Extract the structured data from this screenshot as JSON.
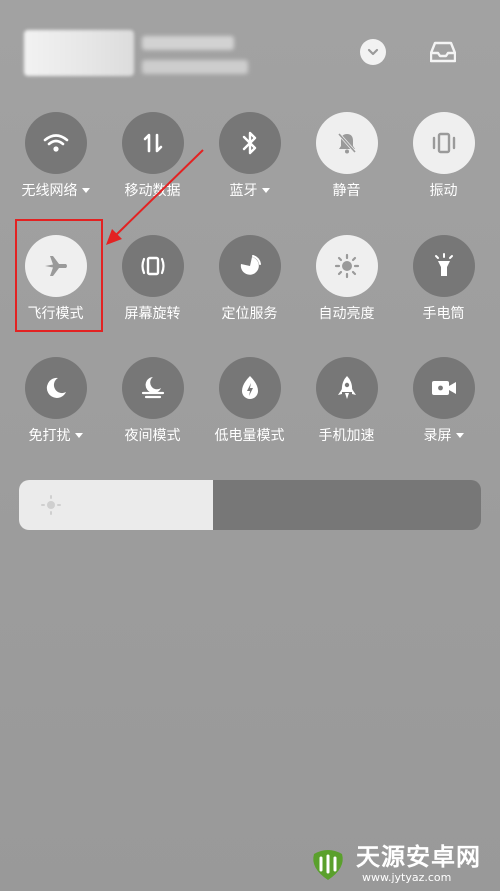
{
  "colors": {
    "tile_off": "#777777",
    "tile_on": "#efefef",
    "icon_on": "#9a9a9a",
    "icon_off": "#ffffff",
    "highlight": "#e32222",
    "brightness_fill": "#ebebeb",
    "brightness_track": "#777777"
  },
  "header": {
    "chevron_icon": "chevron-down-icon",
    "inbox_icon": "inbox-tray-icon"
  },
  "tiles": [
    {
      "label": "无线网络",
      "icon": "wifi-icon",
      "active": false,
      "dropdown": true
    },
    {
      "label": "移动数据",
      "icon": "mobile-data-icon",
      "active": false,
      "dropdown": false
    },
    {
      "label": "蓝牙",
      "icon": "bluetooth-icon",
      "active": false,
      "dropdown": true
    },
    {
      "label": "静音",
      "icon": "bell-mute-icon",
      "active": true,
      "dropdown": false
    },
    {
      "label": "振动",
      "icon": "vibrate-icon",
      "active": true,
      "dropdown": false
    },
    {
      "label": "飞行模式",
      "icon": "airplane-icon",
      "active": true,
      "dropdown": false
    },
    {
      "label": "屏幕旋转",
      "icon": "rotate-screen-icon",
      "active": false,
      "dropdown": false
    },
    {
      "label": "定位服务",
      "icon": "location-icon",
      "active": false,
      "dropdown": false
    },
    {
      "label": "自动亮度",
      "icon": "auto-brightness-icon",
      "active": true,
      "dropdown": false
    },
    {
      "label": "手电筒",
      "icon": "flashlight-icon",
      "active": false,
      "dropdown": false
    },
    {
      "label": "免打扰",
      "icon": "moon-icon",
      "active": false,
      "dropdown": true
    },
    {
      "label": "夜间模式",
      "icon": "night-mode-icon",
      "active": false,
      "dropdown": false
    },
    {
      "label": "低电量模式",
      "icon": "battery-saver-icon",
      "active": false,
      "dropdown": false
    },
    {
      "label": "手机加速",
      "icon": "rocket-icon",
      "active": false,
      "dropdown": false
    },
    {
      "label": "录屏",
      "icon": "video-camera-icon",
      "active": false,
      "dropdown": true
    }
  ],
  "brightness": {
    "level": 0.42,
    "icon": "sun-icon"
  },
  "annotation": {
    "highlighted_tile": "飞行模式"
  },
  "watermark": {
    "title": "天源安卓网",
    "url": "www.jytyaz.com"
  }
}
